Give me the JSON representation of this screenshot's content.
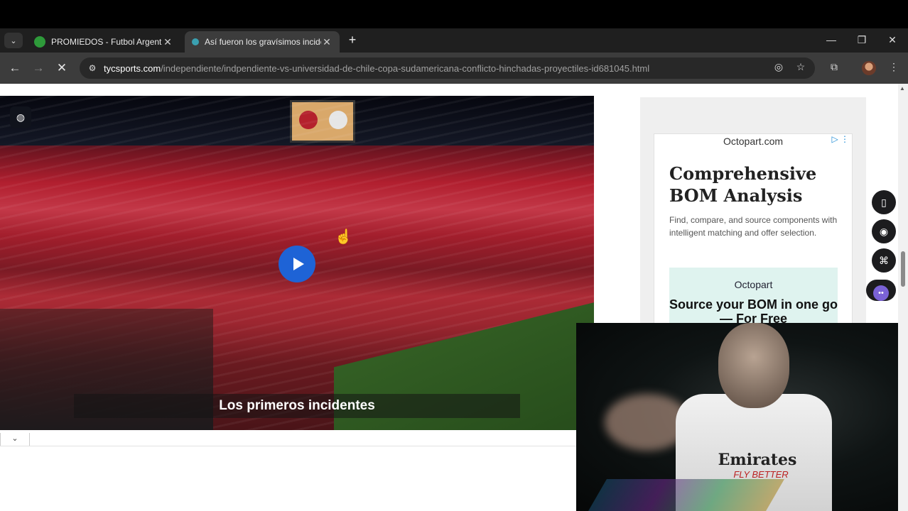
{
  "browser": {
    "tabs": [
      {
        "title": "PROMIEDOS - Futbol Argentino",
        "favicon_color": "#2e9a3a",
        "active": false
      },
      {
        "title": "Así fueron los gravísimos incide",
        "favicon_color": "#3aa0b0",
        "active": true
      }
    ],
    "new_tab_label": "+",
    "url_host": "tycsports.com",
    "url_path": "/independiente/indpendiente-vs-universidad-de-chile-copa-sudamericana-conflicto-hinchadas-proyectiles-id681045.html"
  },
  "video": {
    "caption": "Los primeros incidentes"
  },
  "ad": {
    "host": "Octopart.com",
    "headline": "Comprehensive BOM Analysis",
    "body": "Find, compare, and source components with intelligent matching and offer selection.",
    "promo_brand": "Octopart",
    "promo_cta": "Source your BOM in one go — For Free"
  },
  "webcam": {
    "shirt_sponsor": "Emirates",
    "shirt_tagline": "FLY BETTER"
  },
  "icons": {
    "tab_list": "chevron-down-icon",
    "back": "arrow-left-icon",
    "forward": "arrow-right-icon",
    "stop": "close-icon",
    "site_info": "tune-icon",
    "eye_off": "eye-slash-icon",
    "bookmark": "star-icon",
    "extensions": "puzzle-icon",
    "menu": "kebab-icon"
  }
}
